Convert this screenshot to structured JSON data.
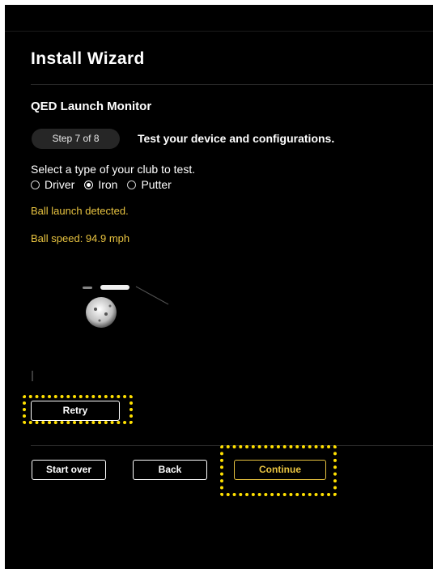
{
  "wizard": {
    "title": "Install Wizard",
    "device": "QED Launch Monitor",
    "step": "Step 7 of 8",
    "step_description": "Test your device and configurations."
  },
  "club_select": {
    "label": "Select a type of your club to test.",
    "options": [
      {
        "label": "Driver",
        "checked": false
      },
      {
        "label": "Iron",
        "checked": true
      },
      {
        "label": "Putter",
        "checked": false
      }
    ]
  },
  "status": {
    "launch": "Ball launch detected.",
    "speed": "Ball speed: 94.9 mph"
  },
  "buttons": {
    "retry": "Retry",
    "start_over": "Start over",
    "back": "Back",
    "continue": "Continue"
  },
  "colors": {
    "background": "#000000",
    "accent": "#e8c340",
    "highlight": "#ffe000"
  }
}
